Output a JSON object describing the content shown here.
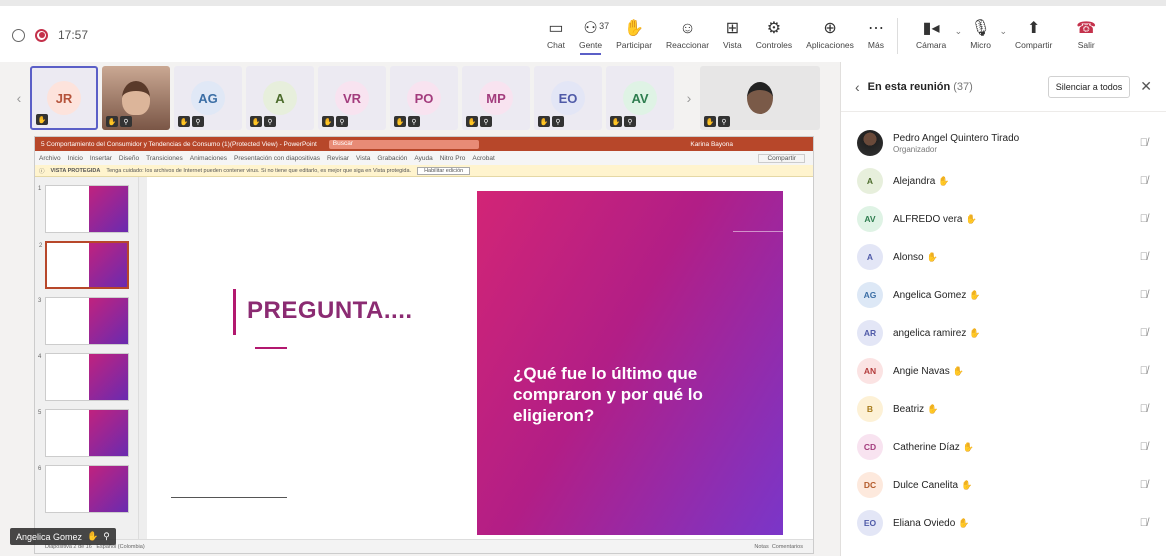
{
  "header": {
    "time": "17:57",
    "tools": [
      {
        "label": "Chat",
        "icon": "chat-icon",
        "glyph": "▭"
      },
      {
        "label": "Gente",
        "icon": "people-icon",
        "glyph": "⚇",
        "count": "37",
        "active": true
      },
      {
        "label": "Participar",
        "icon": "raise-hand-icon",
        "glyph": "✋"
      },
      {
        "label": "Reaccionar",
        "icon": "smile-icon",
        "glyph": "☺"
      },
      {
        "label": "Vista",
        "icon": "grid-icon",
        "glyph": "⊞"
      },
      {
        "label": "Controles",
        "icon": "controls-icon",
        "glyph": "⚙"
      },
      {
        "label": "Aplicaciones",
        "icon": "apps-icon",
        "glyph": "⊕"
      },
      {
        "label": "Más",
        "icon": "more-icon",
        "glyph": "⋯"
      }
    ],
    "camera_label": "Cámara",
    "mic_label": "Micro",
    "share_label": "Compartir",
    "leave_label": "Salir"
  },
  "stage": {
    "tiles": [
      "JR",
      "",
      "AG",
      "A",
      "VR",
      "PO",
      "MP",
      "EO",
      "AV",
      ""
    ],
    "presenter_tag": "Angelica Gomez",
    "ppt": {
      "title": "5 Comportamiento del Consumidor y Tendencias de Consumo (1)(Protected View) - PowerPoint",
      "search": "Buscar",
      "user": "Karina Bayona",
      "menu": [
        "Archivo",
        "Inicio",
        "Insertar",
        "Diseño",
        "Transiciones",
        "Animaciones",
        "Presentación con diapositivas",
        "Revisar",
        "Vista",
        "Grabación",
        "Ayuda",
        "Nitro Pro",
        "Acrobat"
      ],
      "share": "Compartir",
      "warn_label": "VISTA PROTEGIDA",
      "warn_text": "Tenga cuidado: los archivos de Internet pueden contener virus. Si no tiene que editarlo, es mejor que siga en Vista protegida.",
      "warn_button": "Habilitar edición",
      "status_left": "Diapositiva 2 de 16",
      "status_lang": "Español (Colombia)",
      "status_notes": "Notas",
      "status_comments": "Comentarios",
      "thumb_numbers": [
        "1",
        "2",
        "3",
        "4",
        "5",
        "6"
      ],
      "slide": {
        "question": "PREGUNTA....",
        "answer": "¿Qué fue lo último que compraron y por qué lo eligieron?"
      }
    }
  },
  "panel": {
    "title": "En esta reunión",
    "count": "(37)",
    "mute_all": "Silenciar a todos",
    "participants": [
      {
        "initials": "",
        "name": "Pedro Angel Quintero Tirado",
        "role": "Organizador",
        "photo": true,
        "bg": "#333333",
        "fg": "#ffffff",
        "hand": false
      },
      {
        "initials": "A",
        "name": "Alejandra",
        "bg": "#e7efdc",
        "fg": "#4b6b2b",
        "hand": true
      },
      {
        "initials": "AV",
        "name": "ALFREDO vera",
        "bg": "#dff3e5",
        "fg": "#2e7d4f",
        "hand": true
      },
      {
        "initials": "A",
        "name": "Alonso",
        "bg": "#e3e6f6",
        "fg": "#4f5aa8",
        "hand": true
      },
      {
        "initials": "AG",
        "name": "Angelica Gomez",
        "bg": "#dde8f6",
        "fg": "#3b6ea5",
        "hand": true
      },
      {
        "initials": "AR",
        "name": "angelica ramirez",
        "bg": "#e3e6f6",
        "fg": "#4f5aa8",
        "hand": true
      },
      {
        "initials": "AN",
        "name": "Angie Navas",
        "bg": "#fbe3e3",
        "fg": "#b33b3b",
        "hand": true
      },
      {
        "initials": "B",
        "name": "Beatriz",
        "bg": "#fdf1d6",
        "fg": "#a77b1a",
        "hand": true
      },
      {
        "initials": "CD",
        "name": "Catherine Díaz",
        "bg": "#f8e3f0",
        "fg": "#a33c7d",
        "hand": true
      },
      {
        "initials": "DC",
        "name": "Dulce Canelita",
        "bg": "#fde9dd",
        "fg": "#b35a2a",
        "hand": true
      },
      {
        "initials": "EO",
        "name": "Eliana Oviedo",
        "bg": "#e3e6f6",
        "fg": "#4f5aa8",
        "hand": true
      }
    ]
  }
}
